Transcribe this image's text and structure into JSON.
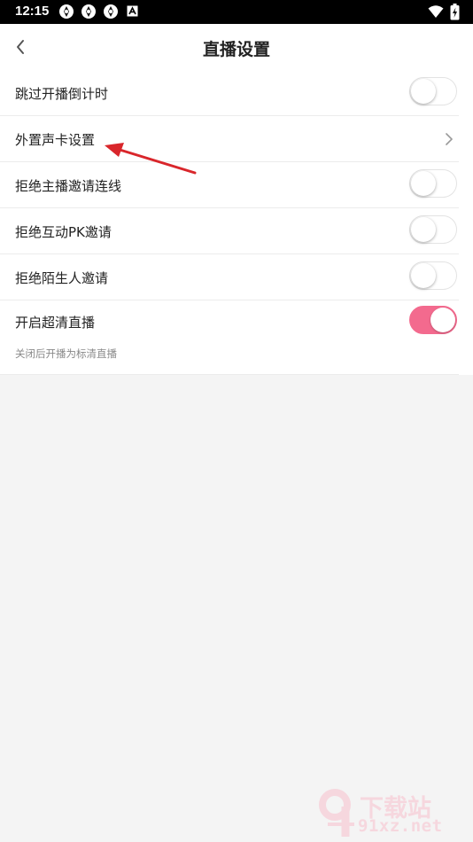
{
  "status_bar": {
    "time": "12:15",
    "icons": [
      "aperture-icon",
      "aperture-icon",
      "aperture-icon",
      "keyboard-a-icon",
      "wifi-icon",
      "battery-charging-icon"
    ]
  },
  "header": {
    "title": "直播设置",
    "back_icon": "chevron-left-icon"
  },
  "settings": [
    {
      "label": "跳过开播倒计时",
      "control": "toggle",
      "on": false
    },
    {
      "label": "外置声卡设置",
      "control": "chevron"
    },
    {
      "label": "拒绝主播邀请连线",
      "control": "toggle",
      "on": false
    },
    {
      "label": "拒绝互动PK邀请",
      "control": "toggle",
      "on": false
    },
    {
      "label": "拒绝陌生人邀请",
      "control": "toggle",
      "on": false
    },
    {
      "label": "开启超清直播",
      "control": "toggle",
      "on": true,
      "sublabel": "关闭后开播为标清直播"
    }
  ],
  "colors": {
    "accent": "#f36a8e",
    "background": "#f4f4f4",
    "annotation_arrow": "#d9262b"
  },
  "watermark": {
    "top": "下载站",
    "bottom": "91xz.net"
  }
}
